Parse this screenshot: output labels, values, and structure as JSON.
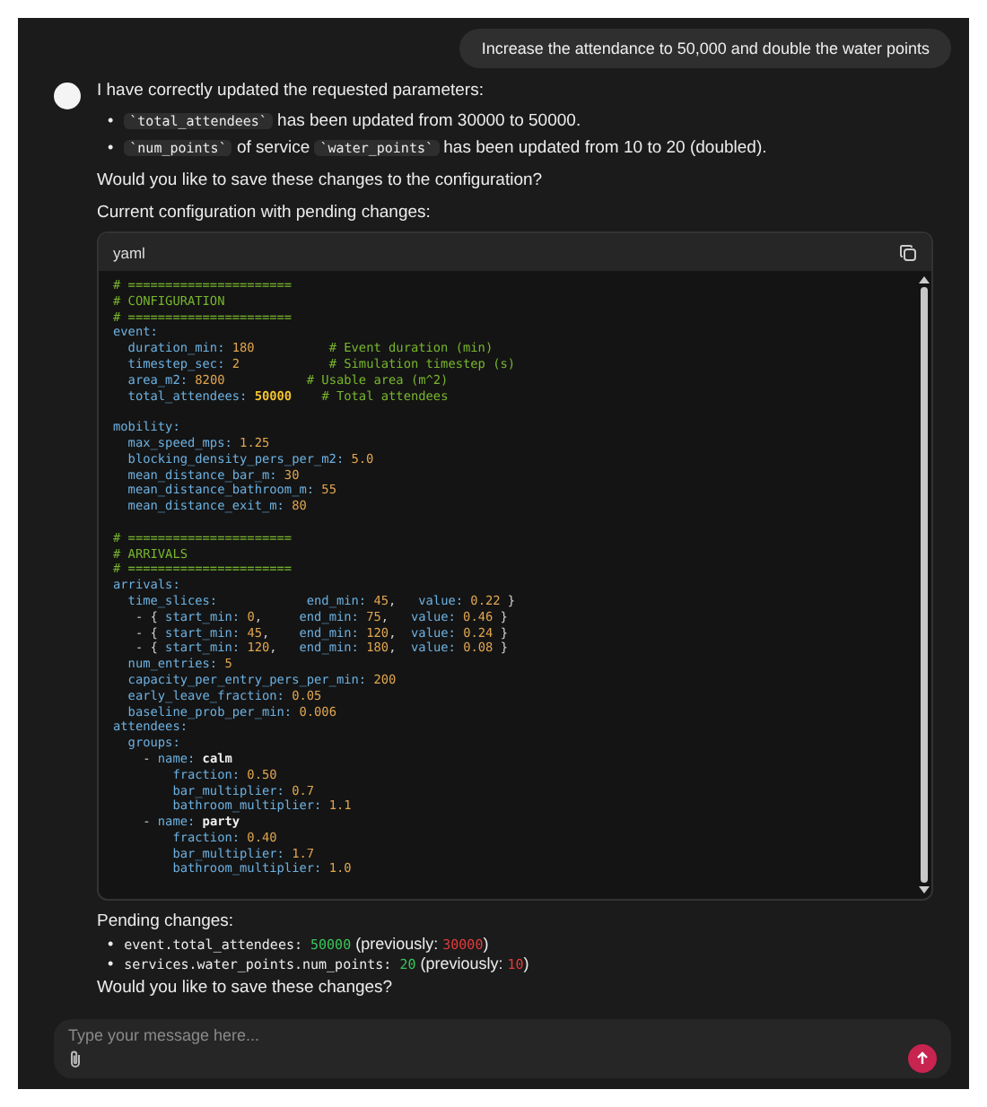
{
  "user_message": "Increase the attendance to 50,000 and double the water points",
  "assistant": {
    "intro": "I have correctly updated the requested parameters:",
    "bullets": [
      {
        "marker": "•",
        "segments": [
          {
            "kind": "code",
            "text": "`total_attendees`"
          },
          {
            "kind": "text",
            "text": " has been updated from 30000 to 50000."
          }
        ]
      },
      {
        "marker": "•",
        "segments": [
          {
            "kind": "code",
            "text": "`num_points`"
          },
          {
            "kind": "text",
            "text": " of service "
          },
          {
            "kind": "code",
            "text": "`water_points`"
          },
          {
            "kind": "text",
            "text": " has been updated from 10 to 20 (doubled)."
          }
        ]
      }
    ],
    "question": "Would you like to save these changes to the configuration?",
    "code_intro": "Current configuration with pending changes:",
    "code_block": {
      "language": "yaml",
      "sections": [
        [
          [
            {
              "kind": "comment",
              "text": "# ======================"
            }
          ],
          [
            {
              "kind": "comment",
              "text": "# CONFIGURATION"
            }
          ],
          [
            {
              "kind": "comment",
              "text": "# ======================"
            }
          ],
          [
            {
              "kind": "key",
              "text": "event:"
            }
          ],
          [
            {
              "kind": "key",
              "text": "  duration_min:"
            },
            {
              "kind": "number",
              "text": " 180"
            },
            {
              "kind": "comment",
              "text": "          # Event duration (min)"
            }
          ],
          [
            {
              "kind": "key",
              "text": "  timestep_sec:"
            },
            {
              "kind": "number",
              "text": " 2"
            },
            {
              "kind": "comment",
              "text": "            # Simulation timestep (s)"
            }
          ],
          [
            {
              "kind": "key",
              "text": "  area_m2:"
            },
            {
              "kind": "number",
              "text": " 8200"
            },
            {
              "kind": "comment",
              "text": "           # Usable area (m^2)"
            }
          ],
          [
            {
              "kind": "key",
              "text": "  total_attendees:"
            },
            {
              "kind": "changed",
              "text": " 50000"
            },
            {
              "kind": "comment",
              "text": "    # Total attendees"
            }
          ]
        ],
        [
          [
            {
              "kind": "key",
              "text": "mobility:"
            }
          ],
          [
            {
              "kind": "key",
              "text": "  max_speed_mps:"
            },
            {
              "kind": "number",
              "text": " 1.25"
            }
          ],
          [
            {
              "kind": "key",
              "text": "  blocking_density_pers_per_m2:"
            },
            {
              "kind": "number",
              "text": " 5.0"
            }
          ],
          [
            {
              "kind": "key",
              "text": "  mean_distance_bar_m:"
            },
            {
              "kind": "number",
              "text": " 30"
            }
          ],
          [
            {
              "kind": "key",
              "text": "  mean_distance_bathroom_m:"
            },
            {
              "kind": "number",
              "text": " 55"
            }
          ],
          [
            {
              "kind": "key",
              "text": "  mean_distance_exit_m:"
            },
            {
              "kind": "number",
              "text": " 80"
            }
          ]
        ],
        [
          [
            {
              "kind": "comment",
              "text": "# ======================"
            }
          ],
          [
            {
              "kind": "comment",
              "text": "# ARRIVALS"
            }
          ],
          [
            {
              "kind": "comment",
              "text": "# ======================"
            }
          ],
          [
            {
              "kind": "key",
              "text": "arrivals:"
            }
          ],
          [
            {
              "kind": "key",
              "text": "  time_slices:"
            },
            {
              "kind": "key",
              "text": "            end_min:"
            },
            {
              "kind": "number",
              "text": " 45"
            },
            {
              "kind": "plain",
              "text": ","
            },
            {
              "kind": "key",
              "text": "   value:"
            },
            {
              "kind": "number",
              "text": " 0.22"
            },
            {
              "kind": "plain",
              "text": " }"
            }
          ],
          [
            {
              "kind": "plain",
              "text": "   - { "
            },
            {
              "kind": "key",
              "text": "start_min:"
            },
            {
              "kind": "number",
              "text": " 0"
            },
            {
              "kind": "plain",
              "text": ","
            },
            {
              "kind": "key",
              "text": "     end_min:"
            },
            {
              "kind": "number",
              "text": " 75"
            },
            {
              "kind": "plain",
              "text": ","
            },
            {
              "kind": "key",
              "text": "   value:"
            },
            {
              "kind": "number",
              "text": " 0.46"
            },
            {
              "kind": "plain",
              "text": " }"
            }
          ],
          [
            {
              "kind": "plain",
              "text": "   - { "
            },
            {
              "kind": "key",
              "text": "start_min:"
            },
            {
              "kind": "number",
              "text": " 45"
            },
            {
              "kind": "plain",
              "text": ","
            },
            {
              "kind": "key",
              "text": "    end_min:"
            },
            {
              "kind": "number",
              "text": " 120"
            },
            {
              "kind": "plain",
              "text": ","
            },
            {
              "kind": "key",
              "text": "  value:"
            },
            {
              "kind": "number",
              "text": " 0.24"
            },
            {
              "kind": "plain",
              "text": " }"
            }
          ],
          [
            {
              "kind": "plain",
              "text": "   - { "
            },
            {
              "kind": "key",
              "text": "start_min:"
            },
            {
              "kind": "number",
              "text": " 120"
            },
            {
              "kind": "plain",
              "text": ","
            },
            {
              "kind": "key",
              "text": "   end_min:"
            },
            {
              "kind": "number",
              "text": " 180"
            },
            {
              "kind": "plain",
              "text": ","
            },
            {
              "kind": "key",
              "text": "  value:"
            },
            {
              "kind": "number",
              "text": " 0.08"
            },
            {
              "kind": "plain",
              "text": " }"
            }
          ],
          [
            {
              "kind": "key",
              "text": "  num_entries:"
            },
            {
              "kind": "number",
              "text": " 5"
            }
          ],
          [
            {
              "kind": "key",
              "text": "  capacity_per_entry_pers_per_min:"
            },
            {
              "kind": "number",
              "text": " 200"
            }
          ],
          [
            {
              "kind": "key",
              "text": "  early_leave_fraction:"
            },
            {
              "kind": "number",
              "text": " 0.05"
            }
          ],
          [
            {
              "kind": "key",
              "text": "  baseline_prob_per_min:"
            },
            {
              "kind": "number",
              "text": " 0.006"
            }
          ],
          [
            {
              "kind": "key",
              "text": "attendees:"
            }
          ],
          [
            {
              "kind": "key",
              "text": "  groups:"
            }
          ],
          [
            {
              "kind": "plain",
              "text": "    - "
            },
            {
              "kind": "key",
              "text": "name:"
            },
            {
              "kind": "strong",
              "text": " calm"
            }
          ],
          [
            {
              "kind": "key",
              "text": "        fraction:"
            },
            {
              "kind": "number",
              "text": " 0.50"
            }
          ],
          [
            {
              "kind": "key",
              "text": "        bar_multiplier:"
            },
            {
              "kind": "number",
              "text": " 0.7"
            }
          ],
          [
            {
              "kind": "key",
              "text": "        bathroom_multiplier:"
            },
            {
              "kind": "number",
              "text": " 1.1"
            }
          ],
          [
            {
              "kind": "plain",
              "text": "    - "
            },
            {
              "kind": "key",
              "text": "name:"
            },
            {
              "kind": "strong",
              "text": " party"
            }
          ],
          [
            {
              "kind": "key",
              "text": "        fraction:"
            },
            {
              "kind": "number",
              "text": " 0.40"
            }
          ],
          [
            {
              "kind": "key",
              "text": "        bar_multiplier:"
            },
            {
              "kind": "number",
              "text": " 1.7"
            }
          ],
          [
            {
              "kind": "key",
              "text": "        bathroom_multiplier:"
            },
            {
              "kind": "number",
              "text": " 1.0"
            }
          ]
        ]
      ]
    },
    "pending_title": "Pending changes:",
    "pending": [
      {
        "marker": "•",
        "path": "event.total_attendees:",
        "new_value": "50000",
        "previous_label": "(previously:",
        "old_value": "30000",
        "close": ")"
      },
      {
        "marker": "•",
        "path": "services.water_points.num_points:",
        "new_value": "20",
        "previous_label": "(previously:",
        "old_value": "10",
        "close": ")"
      }
    ],
    "final_question": "Would you like to save these changes?"
  },
  "composer": {
    "placeholder": "Type your message here..."
  }
}
